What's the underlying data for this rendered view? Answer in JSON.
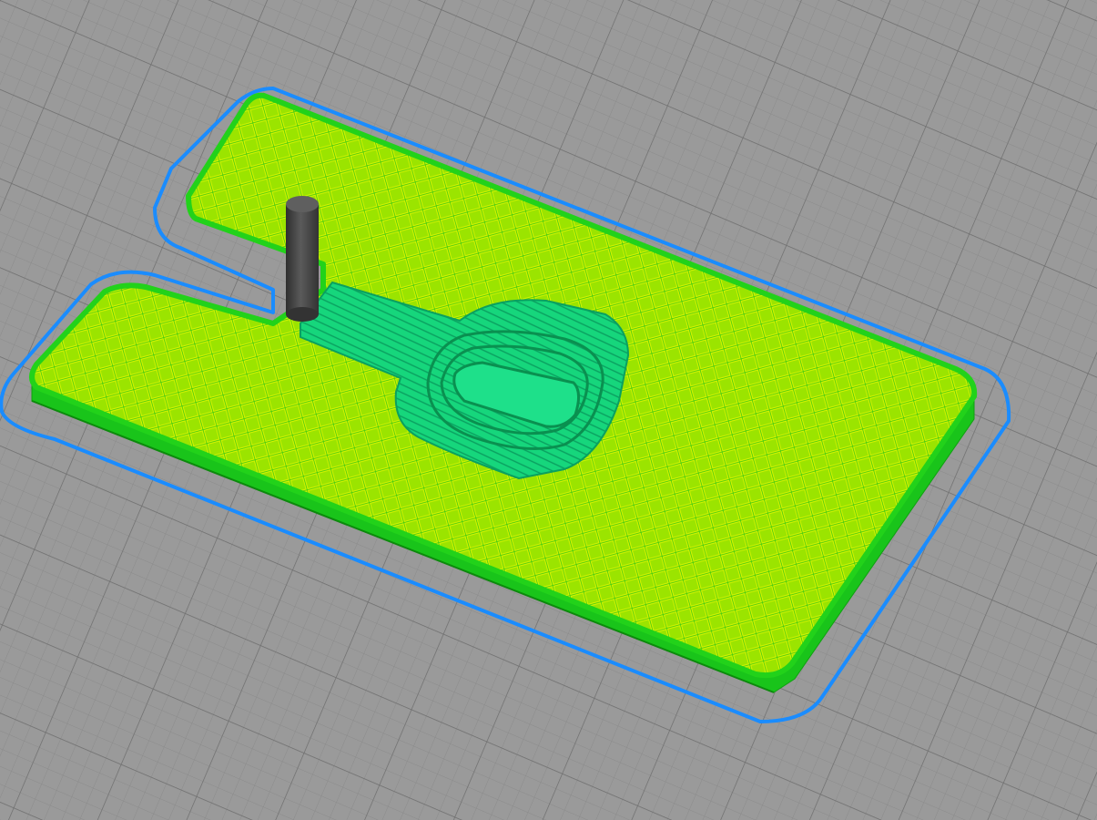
{
  "viewport": {
    "type": "3d-slicer-preview",
    "background_color": "#9a9a9a",
    "grid": true,
    "grid_fine_color": "#8b8b8b",
    "grid_major_color": "#6f6f6f"
  },
  "objects": {
    "skirt": {
      "color": "#1a8cff",
      "label": "skirt"
    },
    "plate": {
      "outline_color": "#22d21a",
      "infill_color": "#c8f000",
      "infill_pattern": "grid",
      "side_color": "#19c41a"
    },
    "coil_region": {
      "color": "#12d880",
      "line_color": "#0aa060"
    },
    "pin": {
      "color": "#4a4a4a",
      "shade_color": "#2e2e2e"
    }
  }
}
